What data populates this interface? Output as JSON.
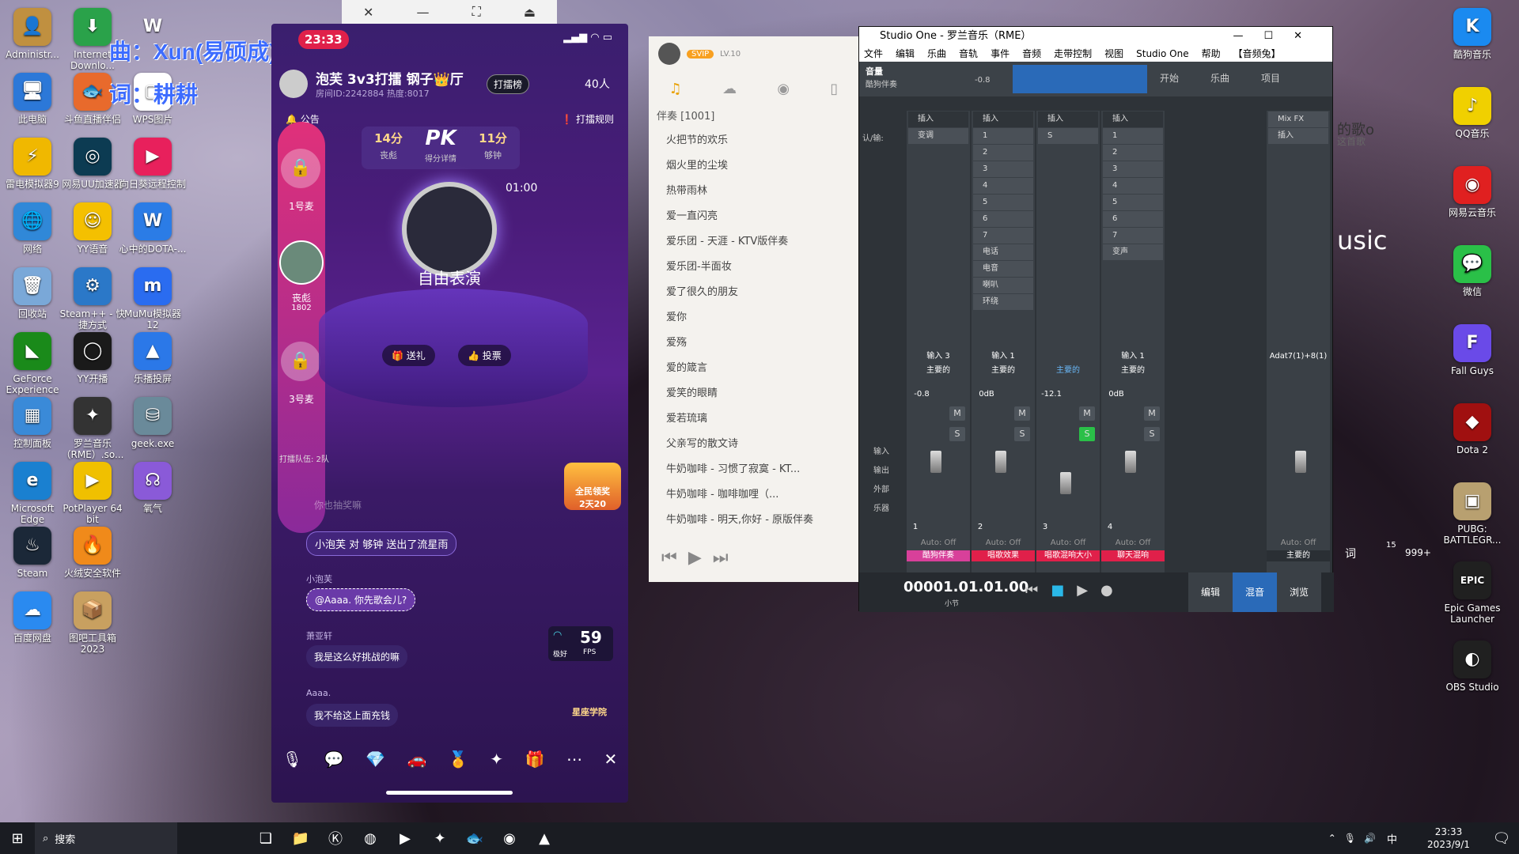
{
  "desktop_left": [
    {
      "label": "Administr...",
      "color": "#c09040",
      "glyph": "👤"
    },
    {
      "label": "Internet Downlo...",
      "color": "#2aa24a",
      "glyph": "⬇"
    },
    {
      "label": "",
      "color": "transparent",
      "glyph": "W"
    },
    {
      "label": "此电脑",
      "color": "#2c78d8",
      "glyph": "🖥"
    },
    {
      "label": "斗鱼直播伴侣",
      "color": "#e86a2c",
      "glyph": "🐟"
    },
    {
      "label": "WPS图片",
      "color": "#ffffff",
      "glyph": "▢"
    },
    {
      "label": "雷电模拟器9",
      "color": "#f0b800",
      "glyph": "⚡"
    },
    {
      "label": "网易UU加速器",
      "color": "#0c3b52",
      "glyph": "◎"
    },
    {
      "label": "向日葵远程控制",
      "color": "#e8205c",
      "glyph": "▶"
    },
    {
      "label": "网络",
      "color": "#3088d8",
      "glyph": "🌐"
    },
    {
      "label": "YY语音",
      "color": "#f4c000",
      "glyph": "☺"
    },
    {
      "label": "心中的DOTA-...",
      "color": "#2b7ce6",
      "glyph": "W"
    },
    {
      "label": "回收站",
      "color": "#7aa8d8",
      "glyph": "🗑"
    },
    {
      "label": "Steam++ - 快捷方式",
      "color": "#2b78c8",
      "glyph": "⚙"
    },
    {
      "label": "MuMu模拟器12",
      "color": "#2a6cf0",
      "glyph": "m"
    },
    {
      "label": "GeForce Experience",
      "color": "#1a8a1a",
      "glyph": "◣"
    },
    {
      "label": "YY开播",
      "color": "#1a1a1a",
      "glyph": "◯"
    },
    {
      "label": "乐播投屏",
      "color": "#2b78e8",
      "glyph": "▲"
    },
    {
      "label": "控制面板",
      "color": "#3a8ad8",
      "glyph": "▦"
    },
    {
      "label": "罗兰音乐（RME）.so...",
      "color": "#333",
      "glyph": "✦"
    },
    {
      "label": "geek.exe",
      "color": "#6a8a9a",
      "glyph": "⛁"
    },
    {
      "label": "Microsoft Edge",
      "color": "#1a80d0",
      "glyph": "e"
    },
    {
      "label": "PotPlayer 64 bit",
      "color": "#f0c000",
      "glyph": "▶"
    },
    {
      "label": "氧气",
      "color": "#8a5ad8",
      "glyph": "☊"
    },
    {
      "label": "Steam",
      "color": "#1b2838",
      "glyph": "♨"
    },
    {
      "label": "火绒安全软件",
      "color": "#f08a1a",
      "glyph": "🔥"
    },
    {
      "label": "",
      "color": "transparent",
      "glyph": ""
    },
    {
      "label": "百度网盘",
      "color": "#2a8af0",
      "glyph": "☁"
    },
    {
      "label": "图吧工具箱2023",
      "color": "#c8a060",
      "glyph": "📦"
    }
  ],
  "desktop_right": [
    {
      "label": "酷狗音乐",
      "color": "#1a8af0",
      "glyph": "K"
    },
    {
      "label": "QQ音乐",
      "color": "#f0d000",
      "glyph": "♪"
    },
    {
      "label": "网易云音乐",
      "color": "#e02020",
      "glyph": "◉"
    },
    {
      "label": "微信",
      "color": "#2ac048",
      "glyph": "💬"
    },
    {
      "label": "Fall Guys",
      "color": "#6a4ae8",
      "glyph": "F"
    },
    {
      "label": "Dota 2",
      "color": "#a01010",
      "glyph": "◆"
    },
    {
      "label": "PUBG: BATTLEGR...",
      "color": "#b8a070",
      "glyph": "▣"
    },
    {
      "label": "Epic Games Launcher",
      "color": "#202020",
      "glyph": "EPIC"
    },
    {
      "label": "OBS Studio",
      "color": "#202020",
      "glyph": "◐"
    }
  ],
  "banner": {
    "line1": "曲：Xun(易硕成)",
    "line2": "词：耕耕"
  },
  "phone": {
    "time": "23:33",
    "room_title": "泡芙 3v3打擂 钢子👑厅",
    "room_id": "房间ID:2242884 热度:8017",
    "rank_btn": "打擂榜",
    "count": "40人",
    "notice": "公告",
    "rules": "打擂规则",
    "score_left": "14分",
    "score_left_sub": "丧彪",
    "pk": "PK",
    "pk_sub": "得分详情",
    "score_right": "11分",
    "score_right_sub": "够钟",
    "timer": "01:00",
    "seat1": "1号麦",
    "seat2_name": "丧彪",
    "seat2_val": "1802",
    "seat3": "3号麦",
    "perform": "自由表演",
    "gift_btn": "送礼",
    "vote_btn": "投票",
    "team": "打擂队伍: 2队",
    "faded_msg": "你也抽奖嘛",
    "msg1": "小泡芙 对 够钟 送出了流星雨",
    "msg2_user": "小泡芙",
    "msg2": "@Aaaa. 你先歌会儿?",
    "msg3_user": "萧亚轩",
    "msg3": "我是这么好挑战的嘛",
    "msg4_user": "Aaaa.",
    "msg4": "我不给这上面充钱",
    "fps": "59",
    "fps_unit": "FPS",
    "signal": "极好",
    "badge_bottom": "星座学院",
    "promo": "全民领奖",
    "promo_time": "2天20"
  },
  "music": {
    "user_badge": "SVIP",
    "level": "LV.10",
    "section": "伴奏 [1001]",
    "songs": [
      "火把节的欢乐",
      "烟火里的尘埃",
      "热带雨林",
      "爱一直闪亮",
      "爱乐团 - 天涯 - KTV版伴奏",
      "爱乐团-半面妆",
      "爱了很久的朋友",
      "爱你",
      "爱殇",
      "爱的箴言",
      "爱笑的眼睛",
      "爱若琉璃",
      "父亲写的散文诗",
      "牛奶咖啡 - 习惯了寂寞 - KT...",
      "牛奶咖啡 - 咖啡咖哩（...",
      "牛奶咖啡 - 明天,你好 - 原版伴奏"
    ]
  },
  "studio": {
    "title": "Studio One - 罗兰音乐（RME）",
    "menu": [
      "文件",
      "编辑",
      "乐曲",
      "音轨",
      "事件",
      "音频",
      "走带控制",
      "视图",
      "Studio One",
      "帮助",
      "【音频兔】"
    ],
    "track_name": "音量",
    "track_sub": "酷狗伴奏",
    "vol": "-0.8",
    "tabs": [
      "开始",
      "乐曲",
      "项目"
    ],
    "insert": "插入",
    "input_label": "认/输:",
    "ch1_slots": [
      "变调"
    ],
    "ch2_slots": [
      "1",
      "2",
      "3",
      "4",
      "5",
      "6",
      "7",
      "电话",
      "电音",
      "喇叭",
      "环绕"
    ],
    "ch3_slots": [
      "S"
    ],
    "ch4_slots": [
      "1",
      "2",
      "3",
      "4",
      "5",
      "6",
      "7",
      "变声"
    ],
    "channels": [
      {
        "input": "输入 3",
        "bus": "主要的",
        "db": "-0.8",
        "num": "1",
        "name": "酷狗伴奏",
        "color": "#d8409a"
      },
      {
        "input": "输入 1",
        "bus": "主要的",
        "db": "0dB",
        "num": "2",
        "name": "唱歌效果",
        "color": "#e0204a"
      },
      {
        "input": "",
        "bus": "主要的",
        "db": "-12.1",
        "num": "3",
        "name": "唱歌混响大小",
        "color": "#e0204a"
      },
      {
        "input": "输入 1",
        "bus": "主要的",
        "db": "0dB",
        "num": "4",
        "name": "聊天混响",
        "color": "#e0204a"
      }
    ],
    "mix_fx": "Mix FX",
    "adat": "Adat7(1)+8(1)",
    "main": "主要的",
    "auto_off": "Auto: Off",
    "side": [
      "输入",
      "输出",
      "外部",
      "乐器"
    ],
    "position": "00001.01.01.00",
    "pos_unit": "小节",
    "bottom_tabs": [
      "编辑",
      "混音",
      "浏览"
    ]
  },
  "taskbar": {
    "search": "搜索",
    "time": "23:33",
    "date": "2023/9/1",
    "ime": "中"
  },
  "bg_text": {
    "song": "的歌o",
    "song_sub": "这首歌",
    "usic": "usic",
    "t15": "15",
    "cnt": "999+",
    "ci": "词"
  }
}
